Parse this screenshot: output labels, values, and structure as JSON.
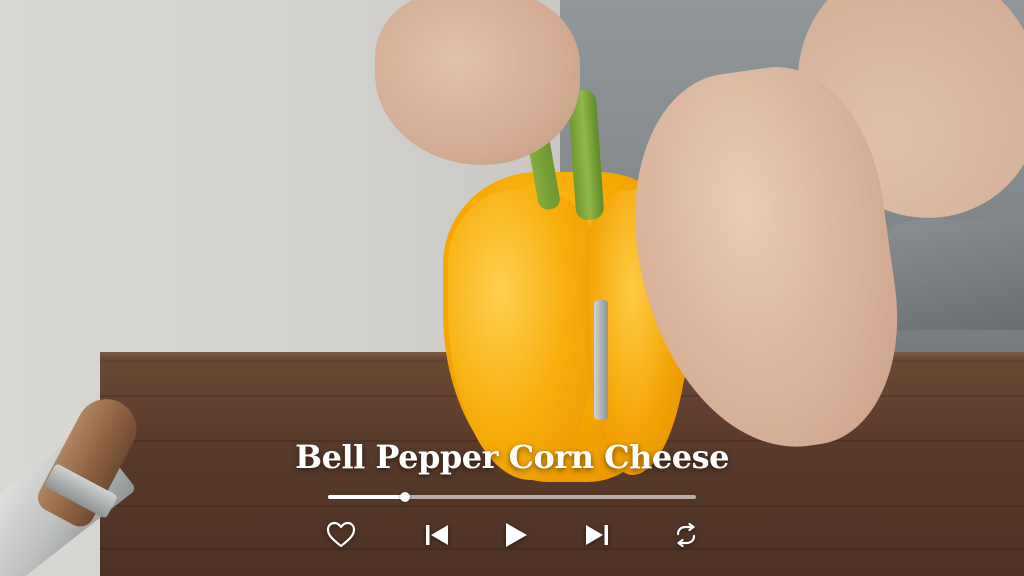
{
  "video": {
    "title": "Bell Pepper Corn Cheese",
    "progress": 0.21
  },
  "controls": {
    "like_icon": "heart-outline-icon",
    "previous_icon": "skip-previous-icon",
    "play_icon": "play-icon",
    "next_icon": "skip-next-icon",
    "repeat_icon": "repeat-icon"
  },
  "colors": {
    "overlay_text": "#ffffff",
    "track": "#ffffff"
  }
}
